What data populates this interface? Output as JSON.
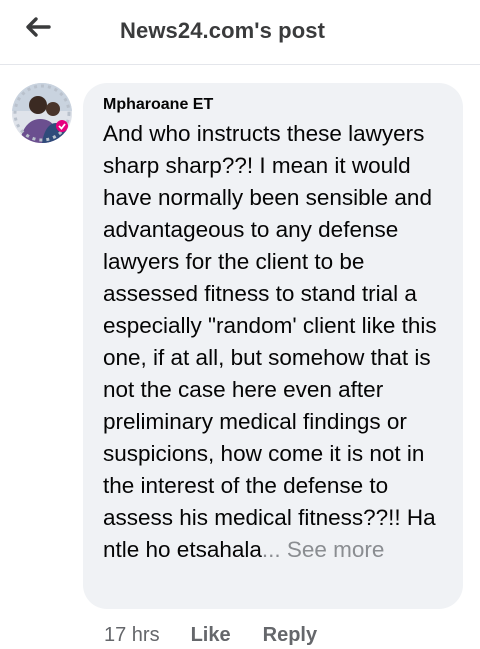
{
  "header": {
    "title": "News24.com's post",
    "back_icon": "arrow-left-icon"
  },
  "comment": {
    "author": "Mpharoane ET",
    "avatar_icon": "profile-photo",
    "text": "And who instructs these lawyers sharp sharp??! I mean it would have normally been sensible and advantageous to any defense lawyers for the client to be assessed fitness to stand trial a especially \"random' client like this one, if at all, but somehow that is not the case here even after preliminary medical findings or suspicions, how come it is not in the interest of the defense to assess his medical fitness??!! Ha ntle ho etsahala",
    "ellipsis": "...",
    "see_more": " See more",
    "time": "17 hrs",
    "like_label": "Like",
    "reply_label": "Reply"
  },
  "colors": {
    "bubble": "#f0f2f5",
    "meta_text": "#65676b",
    "divider": "#e4e6eb"
  }
}
